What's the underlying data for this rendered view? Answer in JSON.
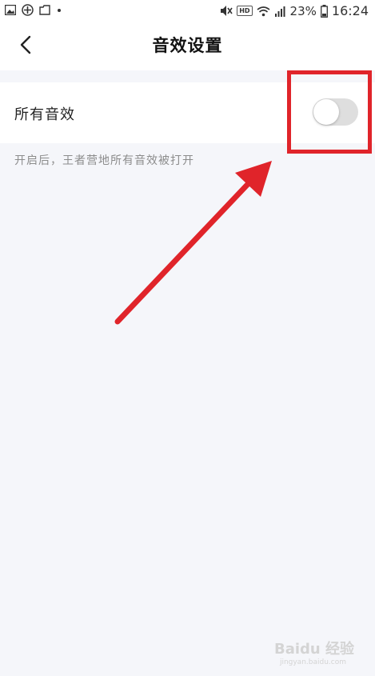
{
  "status_bar": {
    "battery": "23%",
    "time": "16:24",
    "network_badge": "HD",
    "icons": [
      "gallery-icon",
      "game-icon",
      "folder-icon",
      "dot-icon",
      "mute-icon",
      "wifi-icon",
      "signal-icon",
      "battery-icon"
    ]
  },
  "header": {
    "title": "音效设置",
    "back_icon": "chevron-left-icon"
  },
  "settings": {
    "all_sound_label": "所有音效",
    "all_sound_enabled": false,
    "hint": "开启后，王者营地所有音效被打开"
  },
  "annotation": {
    "highlight_color": "#e0242a",
    "arrow_color": "#e0242a"
  },
  "watermark": {
    "brand": "Baidu 经验",
    "url": "jingyan.baidu.com"
  },
  "colors": {
    "background": "#f5f6fa",
    "toggle_off": "#dedede"
  }
}
